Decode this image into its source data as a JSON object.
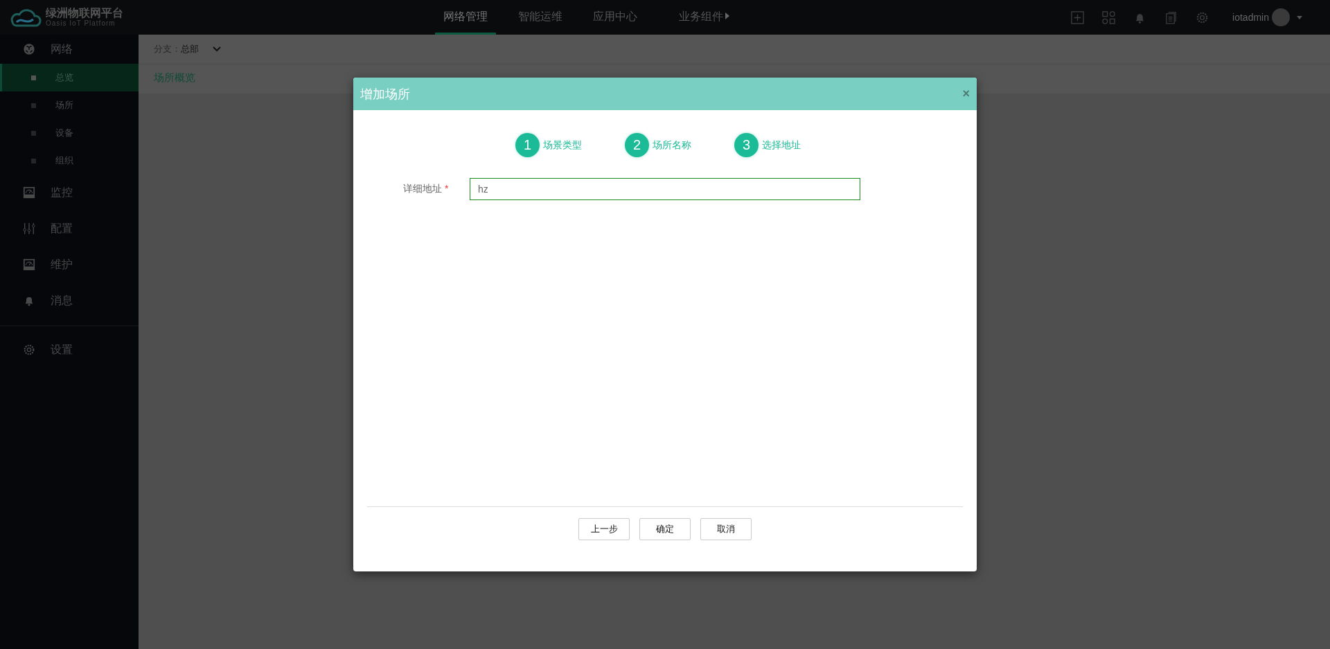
{
  "header": {
    "logo": {
      "title": "绿洲物联网平台",
      "subtitle": "Oasis IoT Platform"
    },
    "nav": [
      {
        "label": "网络管理",
        "selected": true,
        "has_arrow": false
      },
      {
        "label": "智能运维",
        "selected": false,
        "has_arrow": false
      },
      {
        "label": "应用中心",
        "selected": false,
        "has_arrow": false
      },
      {
        "label": "业务组件",
        "selected": false,
        "has_arrow": true
      }
    ],
    "toolbar": [
      {
        "kind": "add"
      },
      {
        "kind": "apps"
      },
      {
        "kind": "bell"
      },
      {
        "kind": "docs"
      },
      {
        "kind": "gear"
      }
    ],
    "user": {
      "name": "iotadmin"
    }
  },
  "sidebar": {
    "groups": [
      {
        "label": "网络",
        "kind": "globe",
        "children": [
          {
            "label": "总览",
            "selected": true
          },
          {
            "label": "场所",
            "selected": false
          },
          {
            "label": "设备",
            "selected": false
          },
          {
            "label": "组织",
            "selected": false
          }
        ]
      },
      {
        "label": "监控",
        "kind": "gauge"
      },
      {
        "label": "配置",
        "kind": "sliders"
      },
      {
        "label": "维护",
        "kind": "gauge"
      },
      {
        "label": "消息",
        "kind": "bell"
      },
      {
        "label": "设置",
        "kind": "gear",
        "divider_before": true
      }
    ]
  },
  "breadcrumb": {
    "label": "分支：",
    "value": "总部"
  },
  "page_title": "场所概览",
  "dialog": {
    "title": "增加场所",
    "close": "×",
    "steps": [
      {
        "number": "1",
        "label": "场景类型"
      },
      {
        "number": "2",
        "label": "场所名称"
      },
      {
        "number": "3",
        "label": "选择地址"
      }
    ],
    "field": {
      "label": "详细地址",
      "required": true,
      "required_mark": "*",
      "value": "hz"
    },
    "buttons": [
      "上一步",
      "确定",
      "取消"
    ]
  }
}
